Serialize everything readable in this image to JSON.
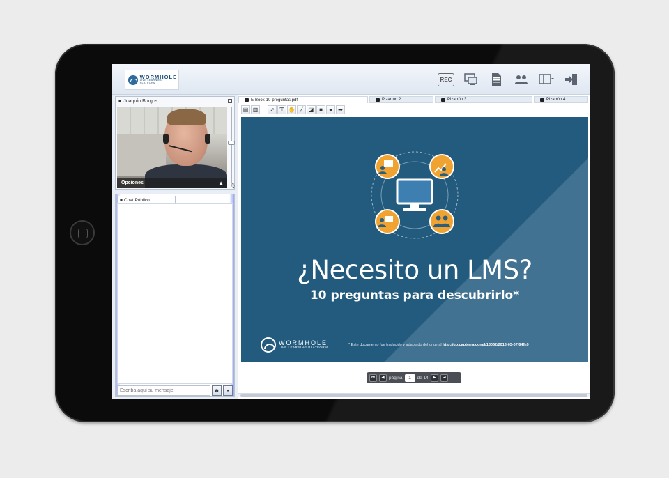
{
  "brand": {
    "logo_name": "WORMHOLE",
    "logo_tagline": "LIVE LEARNING PLATFORM"
  },
  "toolbar": {
    "rec_label": "REC",
    "icons": [
      "rec-icon",
      "share-screen-icon",
      "document-icon",
      "participants-icon",
      "layout-icon",
      "exit-icon"
    ]
  },
  "video": {
    "user_name": "Joaquín  Burgos",
    "options_label": "Opciones"
  },
  "chat": {
    "tab_label": "Chat Público",
    "input_placeholder": "Escriba aquí su mensaje"
  },
  "tabs": [
    {
      "label": "E-Book-10-preguntas.pdf",
      "active": true
    },
    {
      "label": "Pizarrón 2",
      "active": false
    },
    {
      "label": "Pizarrón 3",
      "active": false
    },
    {
      "label": "Pizarrón 4",
      "active": false
    }
  ],
  "tools": [
    "new-page-icon",
    "delete-icon",
    "pointer-icon",
    "text-icon",
    "hand-icon",
    "line-icon",
    "eraser-icon",
    "rectangle-icon",
    "circle-icon",
    "arrow-icon"
  ],
  "slide": {
    "title": "¿Necesito un LMS?",
    "subtitle": "10 preguntas para descubrirlo*",
    "logo_name": "WORMHOLE",
    "logo_tagline": "LIVE LEARNING PLATFORM",
    "footnote": "* Este documento fue traducido y adaptado del original",
    "footnote_link": "http://go.capterra.com/l/13062/2013-03-07/64fh9"
  },
  "pager": {
    "page_label": "página",
    "current_page": "1",
    "total_label": "de 14"
  },
  "colors": {
    "slide_bg": "#235b7f",
    "accent_orange": "#f0a330"
  }
}
